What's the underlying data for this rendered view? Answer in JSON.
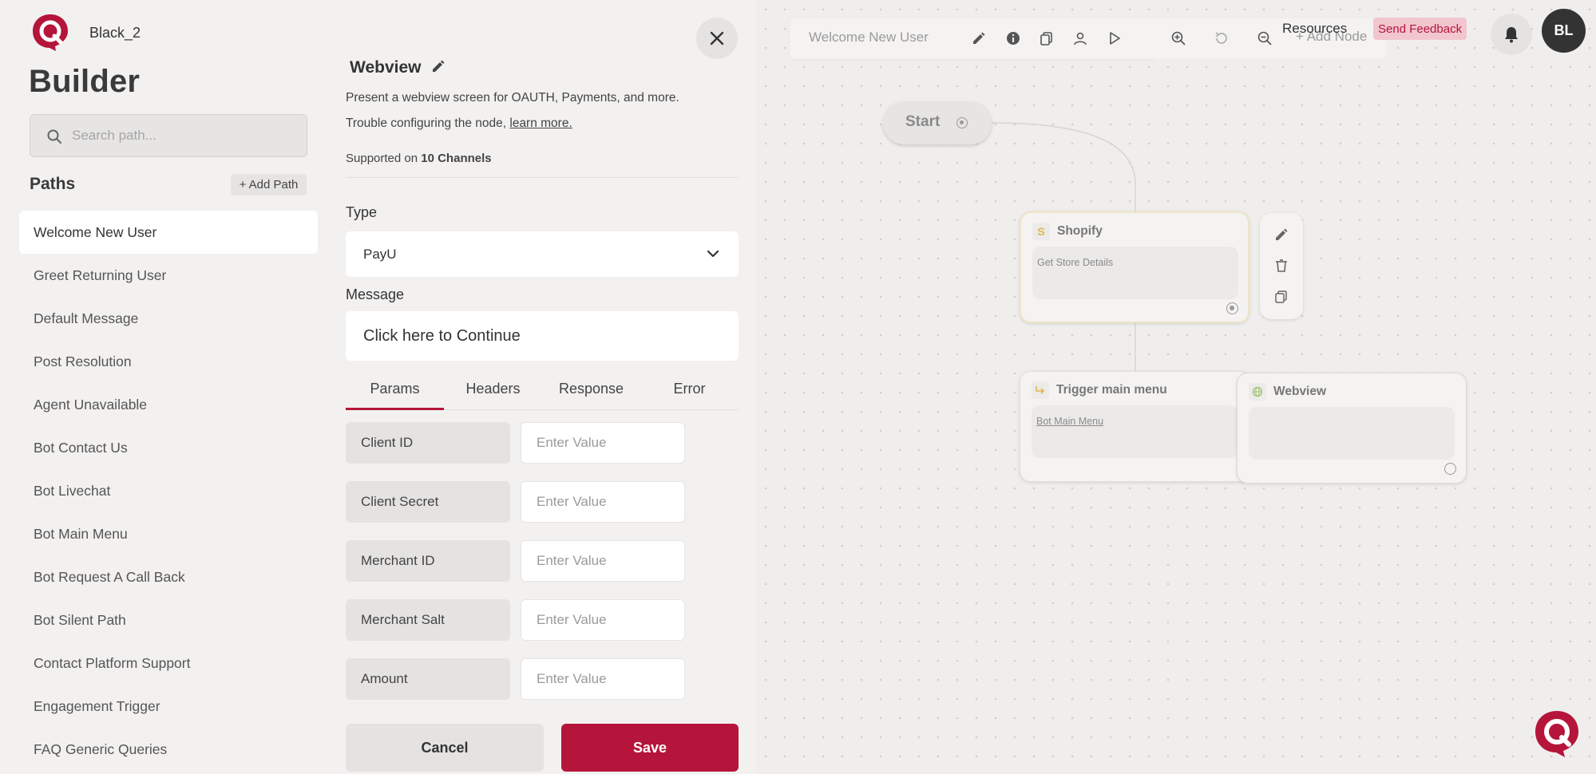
{
  "sidebar": {
    "workspace": "Black_2",
    "title": "Builder",
    "search_placeholder": "Search path...",
    "paths_title": "Paths",
    "add_path_label": "+ Add Path",
    "items": [
      {
        "label": "Welcome New User",
        "active": true
      },
      {
        "label": "Greet Returning User"
      },
      {
        "label": "Default Message"
      },
      {
        "label": "Post Resolution"
      },
      {
        "label": "Agent Unavailable"
      },
      {
        "label": "Bot Contact Us"
      },
      {
        "label": "Bot Livechat"
      },
      {
        "label": "Bot Main Menu"
      },
      {
        "label": "Bot Request A Call Back"
      },
      {
        "label": "Bot Silent Path"
      },
      {
        "label": "Contact Platform Support"
      },
      {
        "label": "Engagement Trigger"
      },
      {
        "label": "FAQ Generic Queries"
      }
    ]
  },
  "panel": {
    "title": "Webview",
    "description": "Present a webview screen for OAUTH, Payments, and more.",
    "trouble_text": "Trouble configuring the node, ",
    "learn_more": "learn more.",
    "supported_prefix": "Supported on ",
    "supported_channels": "10 Channels",
    "type_label": "Type",
    "type_value": "PayU",
    "message_label": "Message",
    "message_value": "Click here to Continue",
    "tabs": [
      "Params",
      "Headers",
      "Response",
      "Error"
    ],
    "active_tab": "Params",
    "params": [
      {
        "key": "Client ID",
        "placeholder": "Enter Value"
      },
      {
        "key": "Client Secret",
        "placeholder": "Enter Value"
      },
      {
        "key": "Merchant ID",
        "placeholder": "Enter Value"
      },
      {
        "key": "Merchant Salt",
        "placeholder": "Enter Value"
      },
      {
        "key": "Amount",
        "placeholder": "Enter Value"
      }
    ],
    "cancel_label": "Cancel",
    "save_label": "Save"
  },
  "canvas": {
    "breadcrumb": "Welcome New User",
    "add_node_label": "+ Add Node",
    "resources_label": "Resources",
    "feedback_label": "Send Feedback",
    "avatar_initials": "BL",
    "start_label": "Start",
    "nodes": {
      "shopify": {
        "title": "Shopify",
        "body": "Get Store Details"
      },
      "trigger": {
        "title": "Trigger main menu",
        "body": "Bot Main Menu"
      },
      "webview": {
        "title": "Webview",
        "body": ""
      }
    }
  },
  "colors": {
    "accent": "#b5153a",
    "background": "#f2f1f0"
  },
  "icons": [
    "logo-icon",
    "search-icon",
    "pencil-icon",
    "close-icon",
    "chevron-down-icon",
    "info-icon",
    "copy-icon",
    "user-icon",
    "play-icon",
    "zoom-in-icon",
    "reset-icon",
    "zoom-out-icon",
    "bell-icon",
    "trash-icon",
    "globe-icon",
    "arrow-icon",
    "chat-fab-icon"
  ]
}
